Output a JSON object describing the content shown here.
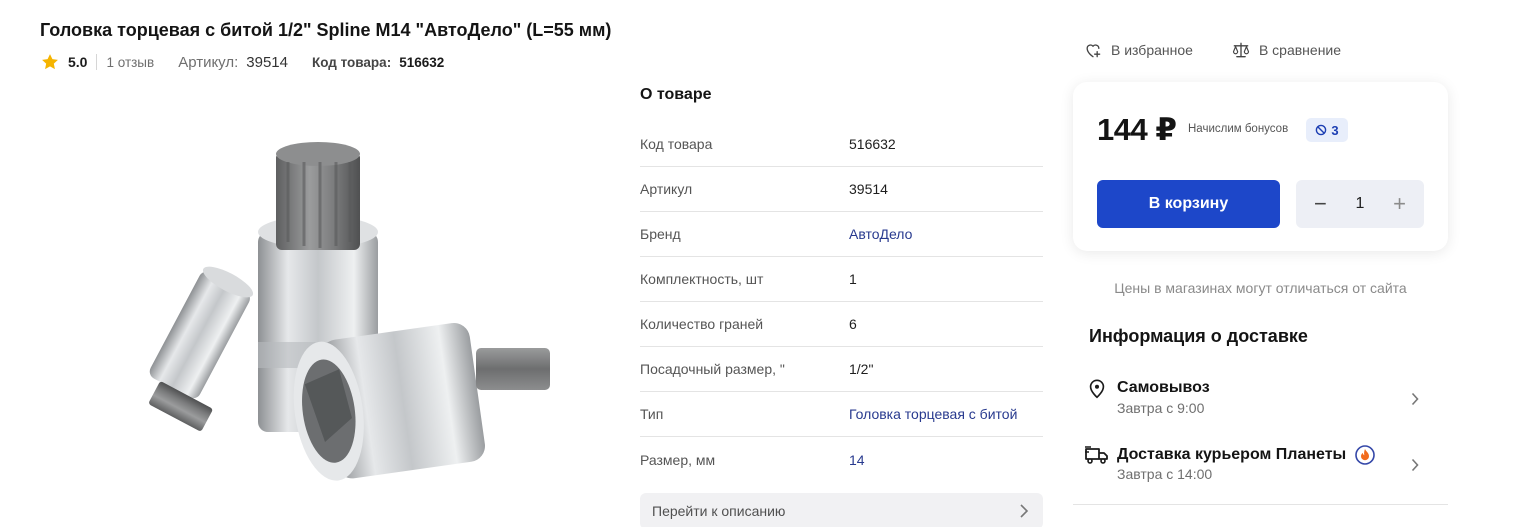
{
  "product": {
    "title": "Головка торцевая с битой 1/2\" Spline M14 \"АвтоДело\" (L=55 мм)",
    "rating": "5.0",
    "reviews": "1 отзыв",
    "article_label": "Артикул:",
    "article_value": "39514",
    "code_label": "Код товара:",
    "code_value": "516632"
  },
  "about": {
    "heading": "О товаре",
    "rows": [
      {
        "key": "Код товара",
        "value": "516632"
      },
      {
        "key": "Артикул",
        "value": "39514"
      },
      {
        "key": "Бренд",
        "value": "АвтоДело"
      },
      {
        "key": "Комплектность, шт",
        "value": "1"
      },
      {
        "key": "Количество граней",
        "value": "6"
      },
      {
        "key": "Посадочный размер, \"",
        "value": "1/2\""
      },
      {
        "key": "Тип",
        "value": "Головка торцевая с битой"
      },
      {
        "key": "Размер, мм",
        "value": "14"
      }
    ],
    "goto_label": "Перейти к описанию"
  },
  "actions": {
    "favorites": "В избранное",
    "compare": "В сравнение"
  },
  "purchase": {
    "price": "144 ₽",
    "bonus_label": "Начислим бонусов",
    "bonus_value": "3",
    "cart_label": "В корзину",
    "quantity": "1",
    "minus": "−",
    "plus": "+"
  },
  "notice": "Цены в магазинах могут отличаться от сайта",
  "delivery": {
    "heading": "Информация о доставке",
    "options": [
      {
        "title": "Самовывоз",
        "subtitle": "Завтра с 9:00"
      },
      {
        "title": "Доставка курьером Планеты",
        "subtitle": "Завтра с 14:00"
      }
    ]
  },
  "colors": {
    "accent": "#1d47c9",
    "link": "#283a8f",
    "star": "#f5b400",
    "flame": "#f26b1d"
  }
}
